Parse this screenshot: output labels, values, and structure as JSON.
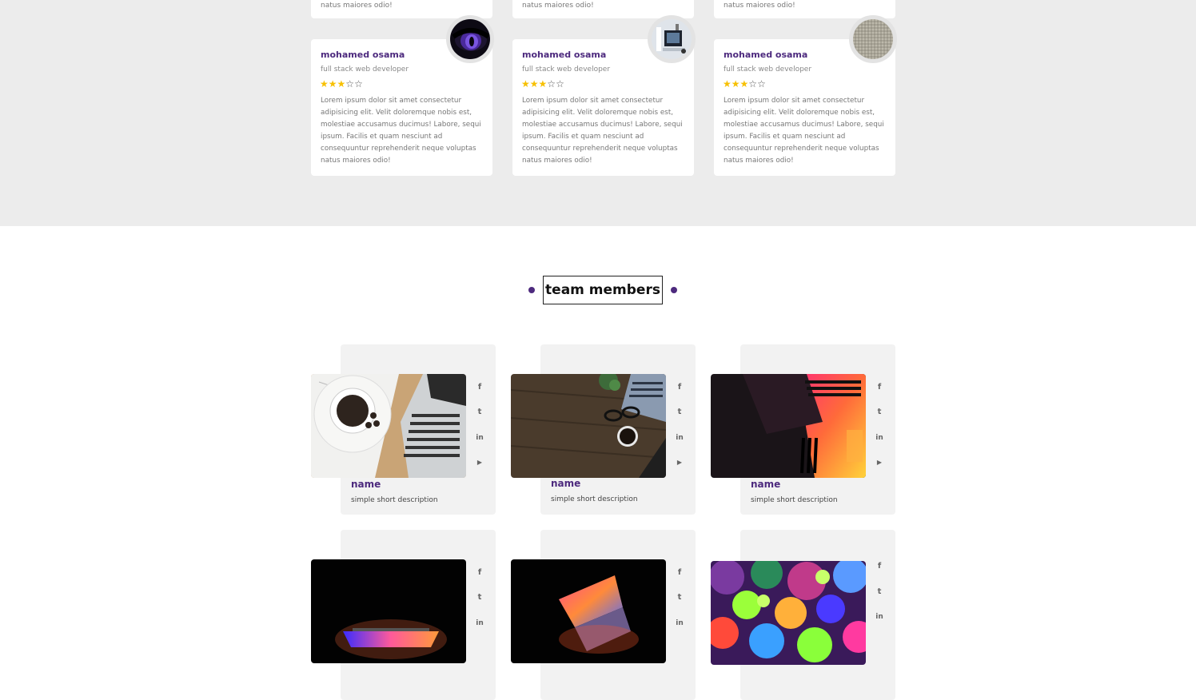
{
  "testimonials": {
    "top_snippets": [
      "natus maiores odio!",
      "natus maiores odio!",
      "natus maiores odio!"
    ],
    "cards": [
      {
        "name": "mohamed osama",
        "role": "full stack web developer",
        "rating": 3,
        "max_rating": 5,
        "text": "Lorem ipsum dolor sit amet consectetur adipisicing elit. Velit doloremque nobis est, molestiae accusamus ducimus! Labore, sequi ipsum. Facilis et quam nesciunt ad consequuntur reprehenderit neque voluptas natus maiores odio!",
        "avatar": "purple-eye-image"
      },
      {
        "name": "mohamed osama",
        "role": "full stack web developer",
        "rating": 3,
        "max_rating": 5,
        "text": "Lorem ipsum dolor sit amet consectetur adipisicing elit. Velit doloremque nobis est, molestiae accusamus ducimus! Labore, sequi ipsum. Facilis et quam nesciunt ad consequuntur reprehenderit neque voluptas natus maiores odio!",
        "avatar": "desk-setup-image"
      },
      {
        "name": "mohamed osama",
        "role": "full stack web developer",
        "rating": 3,
        "max_rating": 5,
        "text": "Lorem ipsum dolor sit amet consectetur adipisicing elit. Velit doloremque nobis est, molestiae accusamus ducimus! Labore, sequi ipsum. Facilis et quam nesciunt ad consequuntur reprehenderit neque voluptas natus maiores odio!",
        "avatar": "fabric-texture-image"
      }
    ]
  },
  "section_title": "team members",
  "team": {
    "social_icons": [
      "facebook-icon",
      "twitter-icon",
      "linkedin-icon",
      "youtube-icon"
    ],
    "social_glyphs": {
      "facebook": "f",
      "twitter": "t",
      "linkedin": "in",
      "youtube": "▶"
    },
    "members": [
      {
        "name": "name",
        "description": "simple short description",
        "photo": "coffee-laptop-photo"
      },
      {
        "name": "name",
        "description": "simple short description",
        "photo": "wooden-desk-photo"
      },
      {
        "name": "name",
        "description": "simple short description",
        "photo": "neon-laptop-photo"
      },
      {
        "name": "",
        "description": "",
        "photo": "dark-laptop-glow-photo"
      },
      {
        "name": "",
        "description": "",
        "photo": "open-laptop-glow-photo"
      },
      {
        "name": "",
        "description": "",
        "photo": "colorful-spheres-photo"
      }
    ]
  },
  "colors": {
    "accent": "#4d2a7e",
    "star": "#f7c000",
    "section_bg": "#ececec"
  }
}
